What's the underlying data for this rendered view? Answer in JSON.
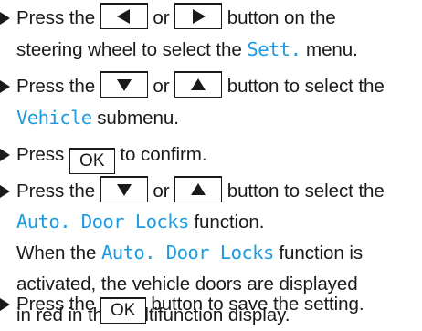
{
  "colors": {
    "text": "#1a1a1a",
    "display_text": "#1e9be0"
  },
  "icons": {
    "bullet": "step-triangle",
    "left": "left-arrow",
    "right": "right-arrow",
    "down": "down-arrow",
    "up": "up-arrow"
  },
  "steps": [
    {
      "lines": [
        {
          "t1": "Press the",
          "t2": "or",
          "t3": "button on the"
        },
        {
          "t1": "steering wheel to select the",
          "d1": "Sett.",
          "t2": "menu."
        }
      ]
    },
    {
      "lines": [
        {
          "t1": "Press the",
          "t2": "or",
          "t3": "button to select the"
        },
        {
          "d1": "Vehicle",
          "t1": "submenu."
        }
      ]
    },
    {
      "lines": [
        {
          "t1": "Press",
          "key": "OK",
          "t2": "to confirm."
        }
      ]
    },
    {
      "lines": [
        {
          "t1": "Press the",
          "t2": "or",
          "t3": "button to select the"
        },
        {
          "d1": "Auto. Door Locks",
          "t1": "function."
        },
        {
          "t1": "When the",
          "d1": "Auto. Door Locks",
          "t2": "function is"
        },
        {
          "t1": "activated, the vehicle doors are displayed"
        },
        {
          "t1": "in red in the multifunction display."
        }
      ]
    },
    {
      "lines": [
        {
          "t1": "Press the",
          "key": "OK",
          "t2": "button to save the setting."
        }
      ]
    }
  ]
}
